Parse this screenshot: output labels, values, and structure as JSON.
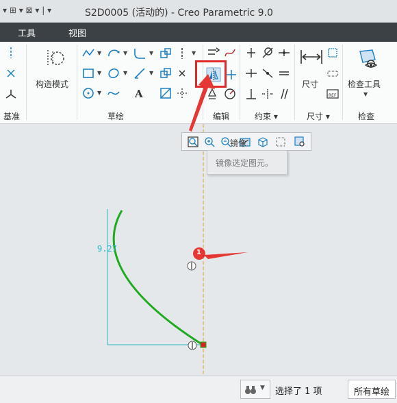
{
  "window": {
    "title": "S2D0005 (活动的) - Creo Parametric 9.0"
  },
  "tabs": [
    {
      "label": "工具"
    },
    {
      "label": "视图"
    }
  ],
  "ribbon": {
    "groups": [
      {
        "label": "基准"
      },
      {
        "label": "草绘"
      },
      {
        "label": "编辑"
      },
      {
        "label": "约束 ▾"
      },
      {
        "label": "尺寸 ▾"
      },
      {
        "label": "检查"
      }
    ],
    "construct_mode_label": "构造模式",
    "dimension_label": "尺寸",
    "inspect_tools_label": "检查工具"
  },
  "tooltip": {
    "title": "镜像",
    "description": "镜像选定图元。"
  },
  "canvas": {
    "dimension_value": "9.27",
    "marker_number": "1"
  },
  "status": {
    "selection_text": "选择了 1 项",
    "filter_value": "所有草绘"
  },
  "colors": {
    "highlight": "#e0292b",
    "sketch_curve": "#1faa1f",
    "centerline": "#e0a030",
    "dimension": "#2bb6c8",
    "ribbon_tabs_bg": "#3c4146"
  }
}
